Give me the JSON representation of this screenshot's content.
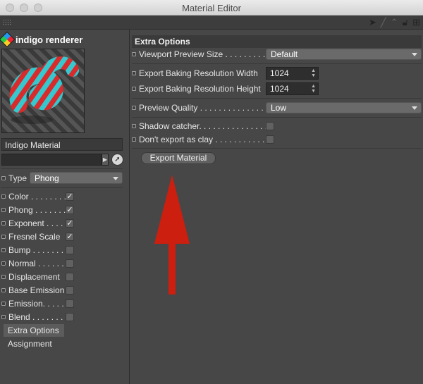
{
  "window": {
    "title": "Material Editor"
  },
  "sidebar": {
    "brand": "indigo renderer",
    "material_name": "Indigo Material",
    "type_label": "Type",
    "type_value": "Phong",
    "channels": [
      {
        "label": "Color . . . . . . . .",
        "checked": true,
        "check": "✓"
      },
      {
        "label": "Phong . . . . . . .",
        "checked": true,
        "check": "✓"
      },
      {
        "label": "Exponent . . . .",
        "checked": true,
        "check": "✓"
      },
      {
        "label": "Fresnel Scale",
        "checked": true,
        "check": "✓"
      },
      {
        "label": "Bump . . . . . . .",
        "checked": false,
        "check": ""
      },
      {
        "label": "Normal . . . . . .",
        "checked": false,
        "check": ""
      },
      {
        "label": "Displacement",
        "checked": false,
        "check": ""
      },
      {
        "label": "Base Emission",
        "checked": false,
        "check": ""
      },
      {
        "label": "Emission. . . . .",
        "checked": false,
        "check": ""
      },
      {
        "label": "Blend . . . . . . .",
        "checked": false,
        "check": ""
      }
    ],
    "items": [
      {
        "label": "Extra Options",
        "active": true
      },
      {
        "label": "Assignment",
        "active": false
      }
    ]
  },
  "main": {
    "section_title": "Extra Options",
    "viewport_preview_label": "Viewport Preview Size . . . . . . . . .",
    "viewport_preview_value": "Default",
    "baking_width_label": "Export Baking Resolution Width",
    "baking_width_value": "1024",
    "baking_height_label": "Export Baking Resolution Height",
    "baking_height_value": "1024",
    "preview_quality_label": "Preview Quality . . . . . . . . . . . . . . .",
    "preview_quality_value": "Low",
    "shadow_catcher_label": "Shadow catcher. . . . . . . . . . . . . . .",
    "clay_label": "Don't export as clay . . . . . . . . . . .",
    "export_button": "Export Material"
  },
  "colors": {
    "annotation_arrow": "#cc1f0f",
    "panel_bg": "#474747"
  }
}
